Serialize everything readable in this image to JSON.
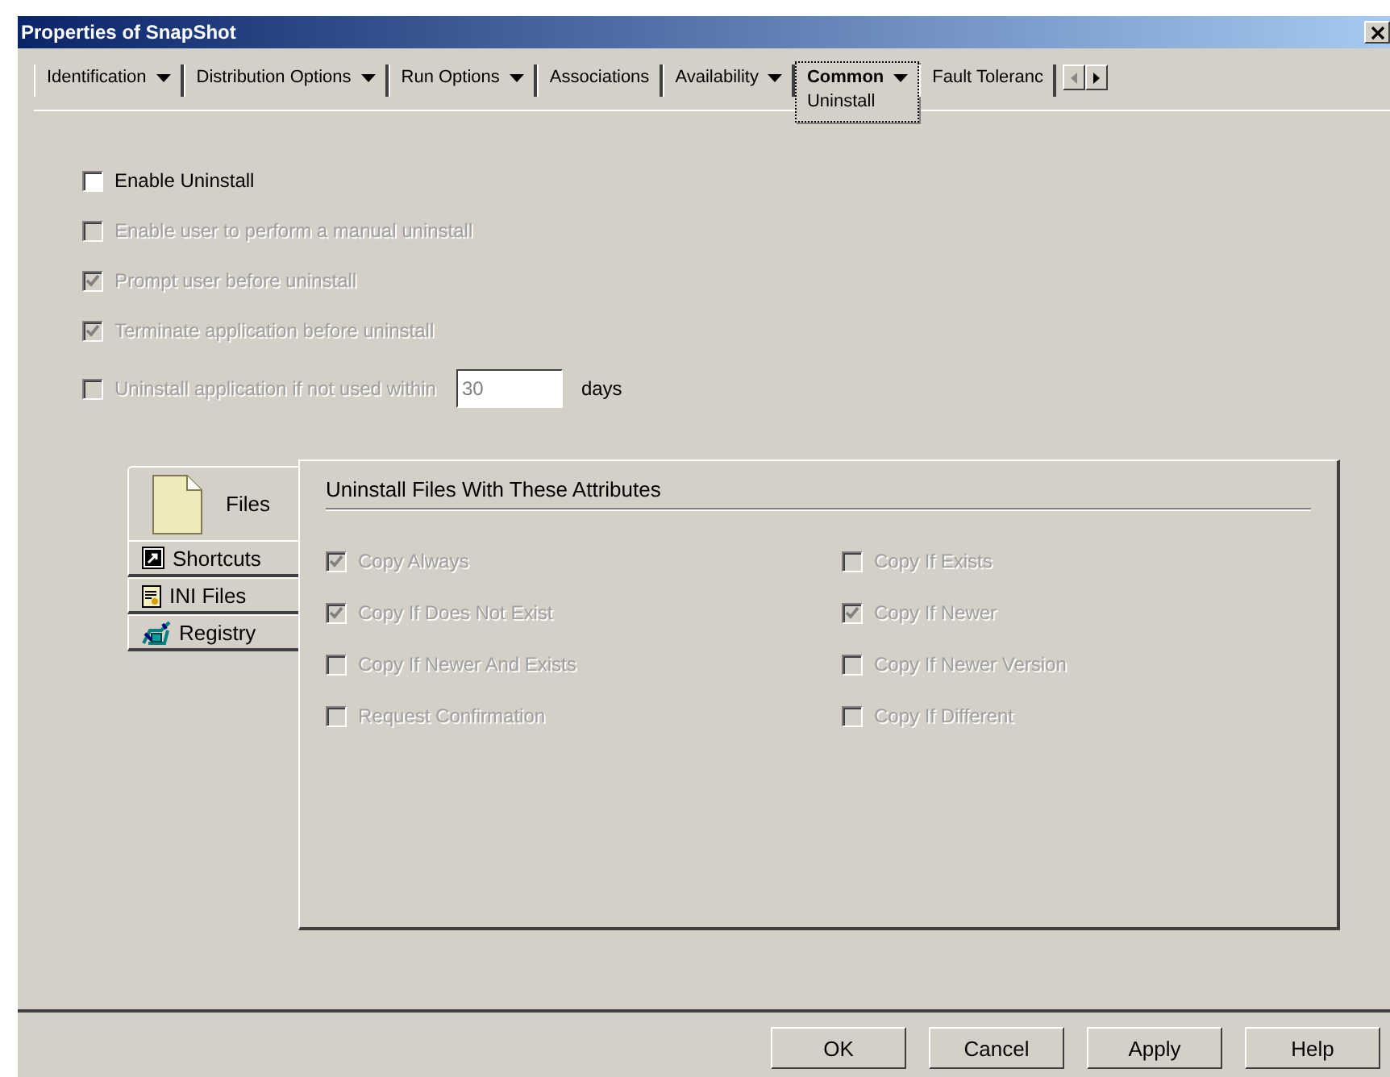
{
  "window": {
    "title": "Properties of SnapShot"
  },
  "tabs": [
    {
      "label": "Identification",
      "dropdown": true,
      "selected": false
    },
    {
      "label": "Distribution Options",
      "dropdown": true,
      "selected": false
    },
    {
      "label": "Run Options",
      "dropdown": true,
      "selected": false
    },
    {
      "label": "Associations",
      "dropdown": false,
      "selected": false
    },
    {
      "label": "Availability",
      "dropdown": true,
      "selected": false
    },
    {
      "label": "Common",
      "dropdown": true,
      "selected": true,
      "subtab": "Uninstall"
    },
    {
      "label": "Fault Toleranc",
      "dropdown": false,
      "selected": false
    }
  ],
  "options": [
    {
      "label": "Enable Uninstall",
      "checked": false,
      "disabled": false
    },
    {
      "label": "Enable user to perform a manual uninstall",
      "checked": false,
      "disabled": true
    },
    {
      "label": "Prompt user before uninstall",
      "checked": true,
      "disabled": true
    },
    {
      "label": "Terminate application before uninstall",
      "checked": true,
      "disabled": true
    },
    {
      "label": "Uninstall application if not used within",
      "checked": false,
      "disabled": true,
      "field_value": "30",
      "suffix": "days"
    }
  ],
  "side_tabs": [
    {
      "label": "Files",
      "kind": "files",
      "selected": true
    },
    {
      "label": "Shortcuts",
      "kind": "shortcuts",
      "selected": false
    },
    {
      "label": "INI Files",
      "kind": "ini",
      "selected": false
    },
    {
      "label": "Registry",
      "kind": "registry",
      "selected": false
    }
  ],
  "attributes": {
    "heading": "Uninstall Files With These Attributes",
    "items": [
      {
        "label": "Copy Always",
        "checked": true,
        "disabled": true
      },
      {
        "label": "Copy If Exists",
        "checked": false,
        "disabled": true
      },
      {
        "label": "Copy If Does Not Exist",
        "checked": true,
        "disabled": true
      },
      {
        "label": "Copy If Newer",
        "checked": true,
        "disabled": true
      },
      {
        "label": "Copy If Newer And Exists",
        "checked": false,
        "disabled": true
      },
      {
        "label": "Copy If Newer Version",
        "checked": false,
        "disabled": true
      },
      {
        "label": "Request Confirmation",
        "checked": false,
        "disabled": true
      },
      {
        "label": "Copy If Different",
        "checked": false,
        "disabled": true
      }
    ]
  },
  "buttons": [
    "OK",
    "Cancel",
    "Apply",
    "Help"
  ]
}
